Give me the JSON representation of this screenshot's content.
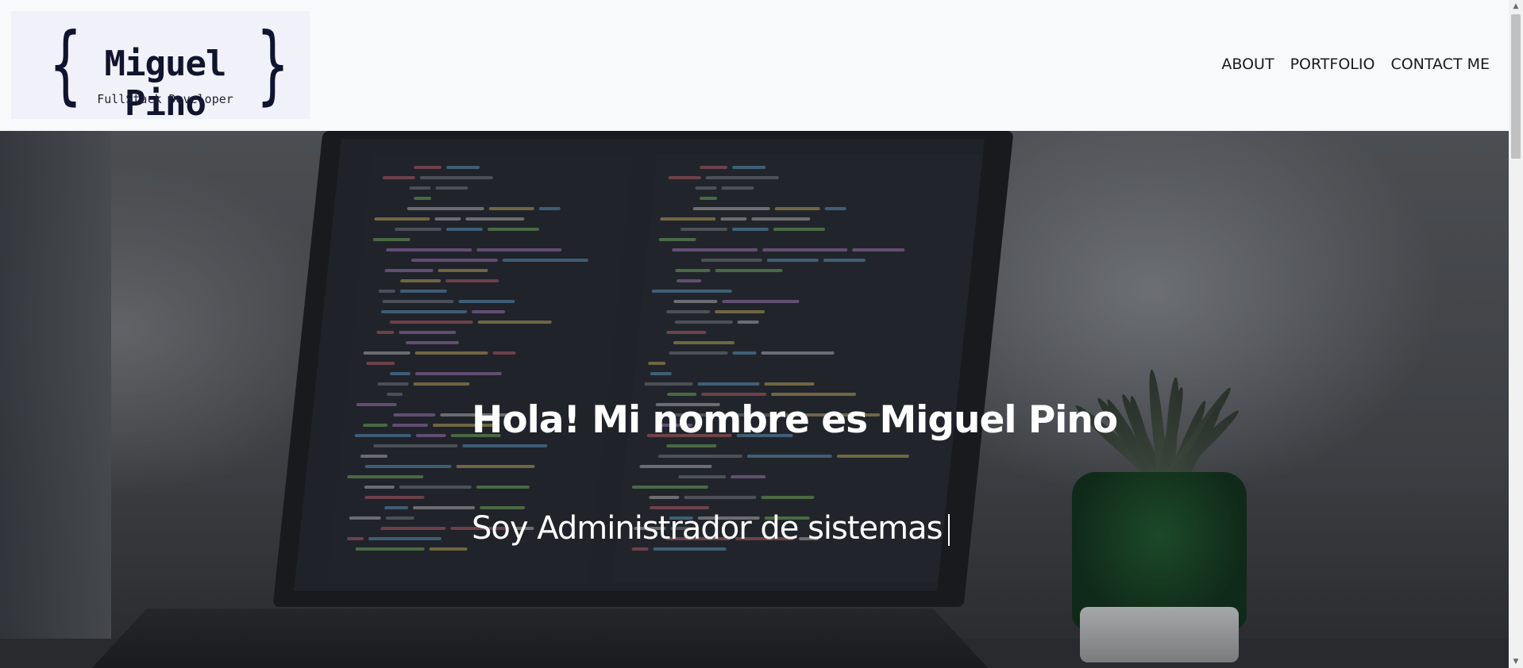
{
  "logo": {
    "name": "Miguel Pino",
    "subtitle": "FullStack Developer",
    "brace_left": "{",
    "brace_right": "}"
  },
  "nav": {
    "items": [
      {
        "label": "ABOUT"
      },
      {
        "label": "PORTFOLIO"
      },
      {
        "label": "CONTACT ME"
      }
    ]
  },
  "hero": {
    "title": "Hola! Mi nombre es Miguel Pino",
    "subtitle": "Soy Administrador de sistemas"
  },
  "colors": {
    "header_bg": "#f8f9fb",
    "logo_text": "#10142e",
    "hero_text": "#ffffff"
  }
}
